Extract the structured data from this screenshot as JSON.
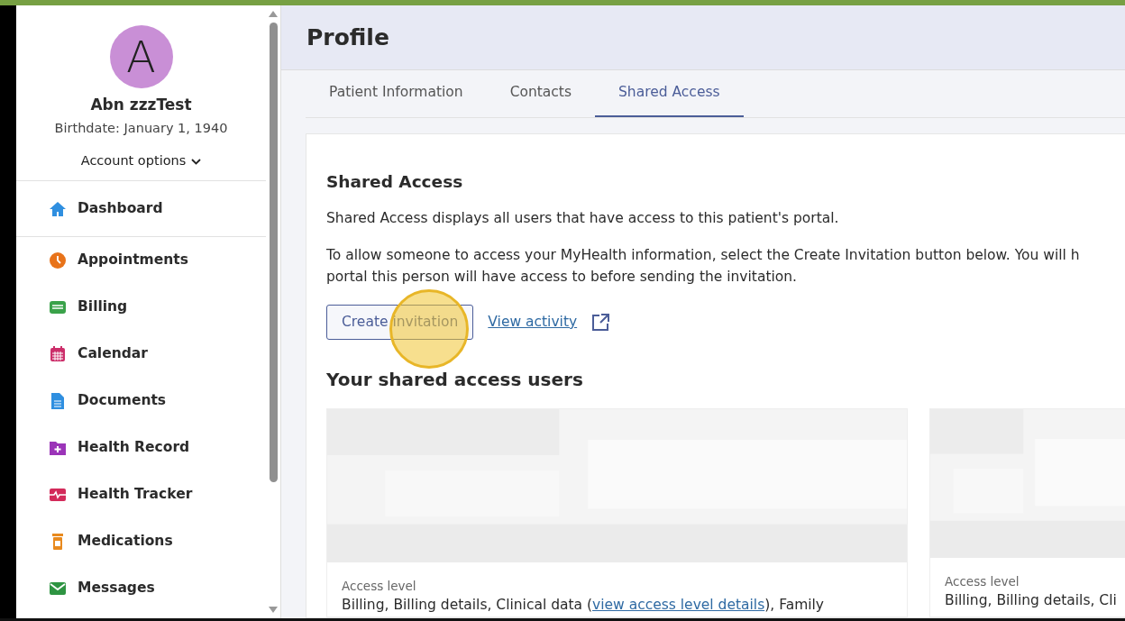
{
  "user": {
    "initial": "A",
    "name": "Abn zzzTest",
    "birthdate": "Birthdate: January 1, 1940",
    "account_options": "Account options"
  },
  "sidebar": {
    "items": [
      {
        "label": "Dashboard",
        "kind": "home"
      },
      {
        "label": "Appointments",
        "kind": "clock"
      },
      {
        "label": "Billing",
        "kind": "wallet"
      },
      {
        "label": "Calendar",
        "kind": "calendar"
      },
      {
        "label": "Documents",
        "kind": "document"
      },
      {
        "label": "Health Record",
        "kind": "folder"
      },
      {
        "label": "Health Tracker",
        "kind": "pulse"
      },
      {
        "label": "Medications",
        "kind": "bottle"
      },
      {
        "label": "Messages",
        "kind": "mail"
      }
    ]
  },
  "page_title": "Profile",
  "tabs": [
    {
      "label": "Patient Information",
      "selected": false
    },
    {
      "label": "Contacts",
      "selected": false
    },
    {
      "label": "Shared Access",
      "selected": true
    }
  ],
  "section": {
    "title": "Shared Access",
    "description": "Shared Access displays all users that have access to this patient's portal.",
    "instructions": [
      "To allow someone to access your MyHealth information, select the Create Invitation button below. You will h",
      "portal this person will have access to before sending the invitation."
    ],
    "create_button": "Create invitation",
    "view_activity": "View activity",
    "users_title": "Your shared access users"
  },
  "users": [
    {
      "access_label": "Access level",
      "access_before": "Billing, Billing details, Clinical data (",
      "access_link": "view access level details",
      "access_after": "), Family"
    },
    {
      "access_label": "Access level",
      "access_before": "Billing, Billing details, Cli"
    }
  ]
}
